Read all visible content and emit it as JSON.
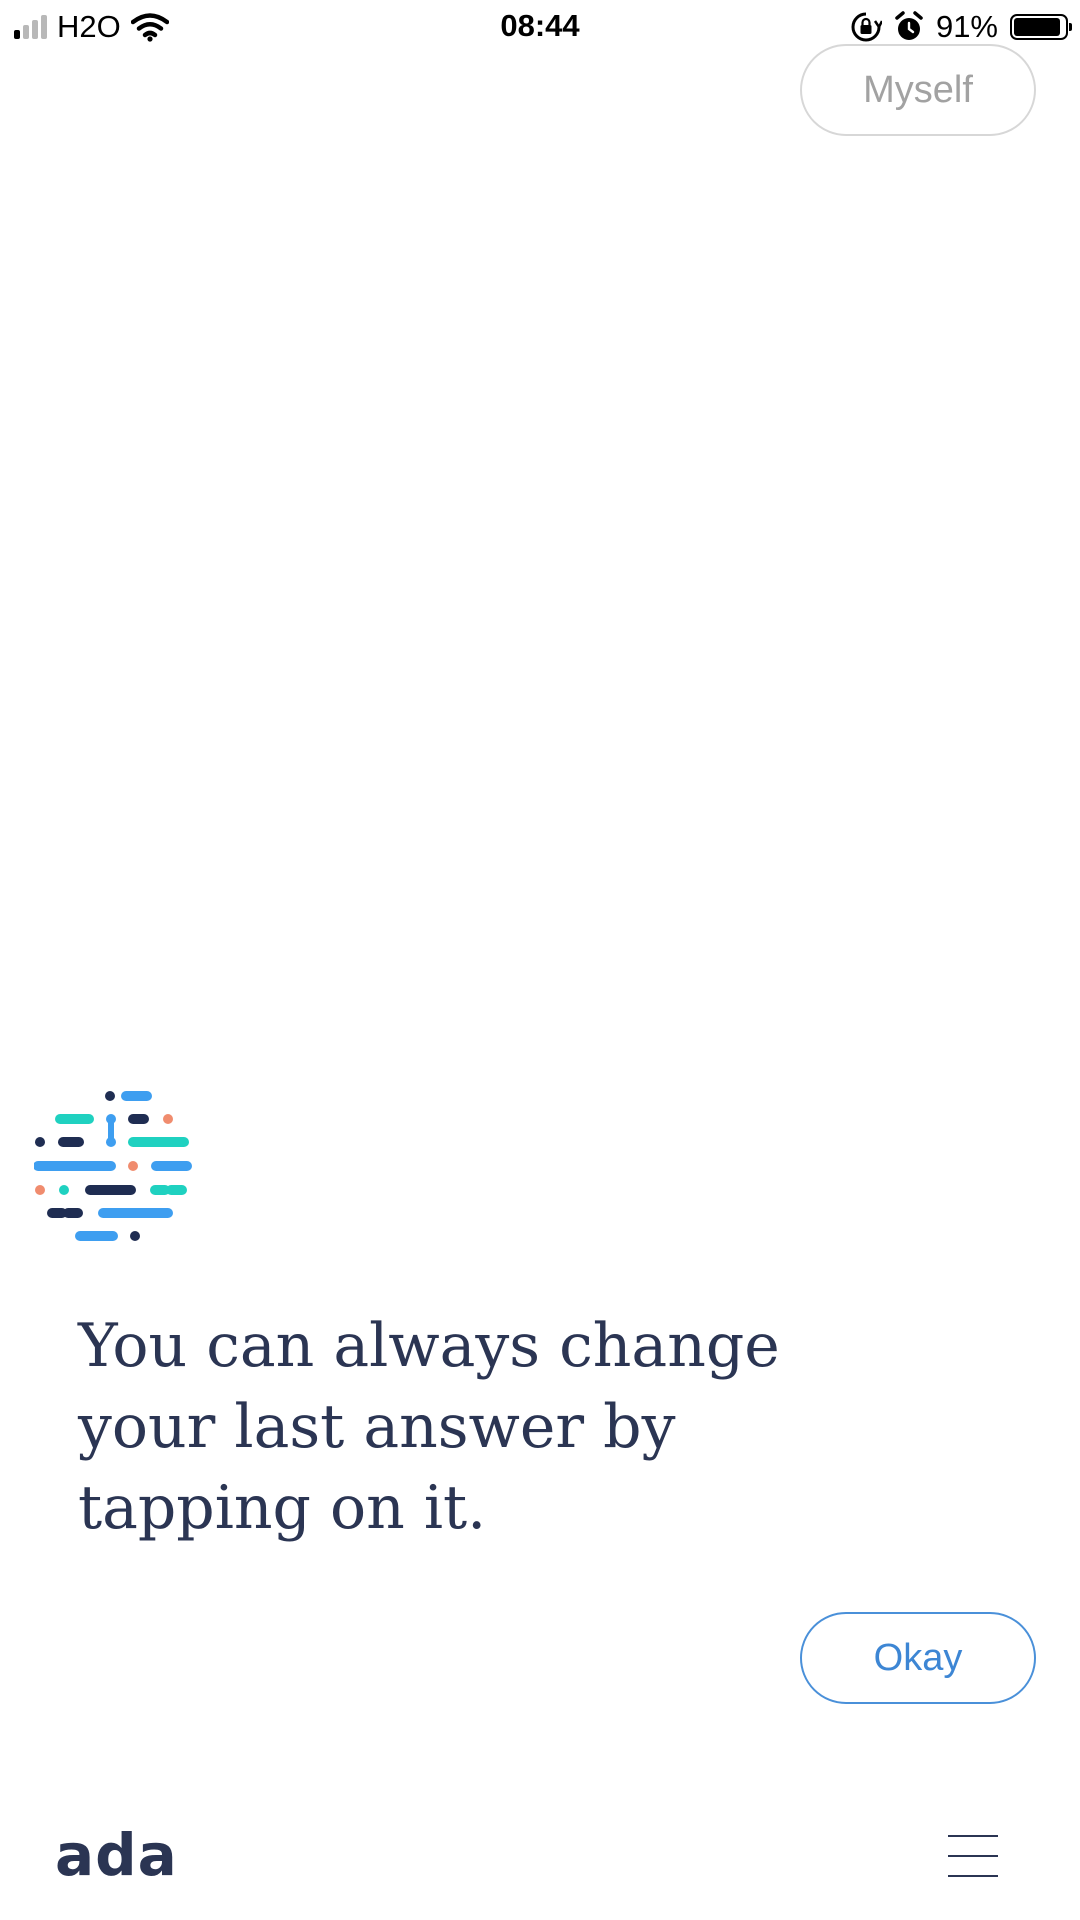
{
  "status_bar": {
    "carrier": "H2O",
    "time": "08:44",
    "battery_percent": "91%",
    "battery_level": 0.91,
    "signal_bars_filled": 1,
    "signal_bars_total": 4,
    "icons": [
      "signal-icon",
      "wifi-icon",
      "rotation-lock-icon",
      "alarm-icon",
      "battery-icon"
    ]
  },
  "chat": {
    "previous_answer_label": "Myself",
    "bot_message": "You can always change your last answer by tapping on it.",
    "reply_option_label": "Okay"
  },
  "footer": {
    "logo_text": "ada",
    "menu_icon": "hamburger-menu-icon"
  },
  "colors": {
    "text_dark": "#2b3553",
    "accent_blue": "#3d86d4",
    "muted_grey": "#a2a2a2",
    "teal": "#1fd1c0",
    "light_blue": "#3e9ef0",
    "navy": "#1f2d52",
    "salmon": "#f08c6e"
  }
}
